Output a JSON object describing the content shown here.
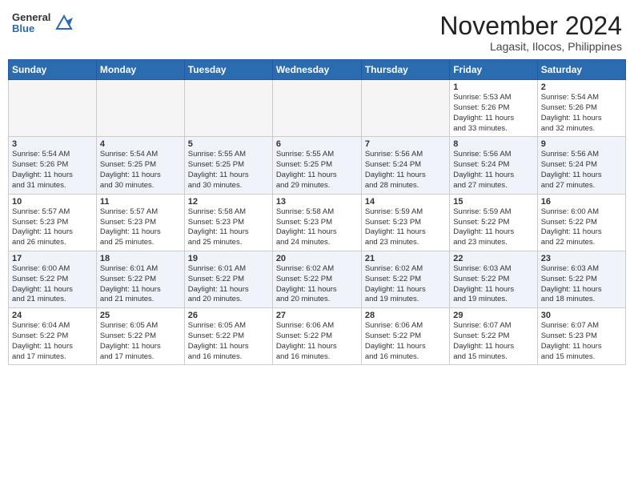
{
  "header": {
    "logo_general": "General",
    "logo_blue": "Blue",
    "month_year": "November 2024",
    "location": "Lagasit, Ilocos, Philippines"
  },
  "days_of_week": [
    "Sunday",
    "Monday",
    "Tuesday",
    "Wednesday",
    "Thursday",
    "Friday",
    "Saturday"
  ],
  "weeks": [
    {
      "row_class": "row-white",
      "days": [
        {
          "num": "",
          "info": "",
          "empty": true
        },
        {
          "num": "",
          "info": "",
          "empty": true
        },
        {
          "num": "",
          "info": "",
          "empty": true
        },
        {
          "num": "",
          "info": "",
          "empty": true
        },
        {
          "num": "",
          "info": "",
          "empty": true
        },
        {
          "num": "1",
          "info": "Sunrise: 5:53 AM\nSunset: 5:26 PM\nDaylight: 11 hours\nand 33 minutes."
        },
        {
          "num": "2",
          "info": "Sunrise: 5:54 AM\nSunset: 5:26 PM\nDaylight: 11 hours\nand 32 minutes."
        }
      ]
    },
    {
      "row_class": "row-blue",
      "days": [
        {
          "num": "3",
          "info": "Sunrise: 5:54 AM\nSunset: 5:26 PM\nDaylight: 11 hours\nand 31 minutes."
        },
        {
          "num": "4",
          "info": "Sunrise: 5:54 AM\nSunset: 5:25 PM\nDaylight: 11 hours\nand 30 minutes."
        },
        {
          "num": "5",
          "info": "Sunrise: 5:55 AM\nSunset: 5:25 PM\nDaylight: 11 hours\nand 30 minutes."
        },
        {
          "num": "6",
          "info": "Sunrise: 5:55 AM\nSunset: 5:25 PM\nDaylight: 11 hours\nand 29 minutes."
        },
        {
          "num": "7",
          "info": "Sunrise: 5:56 AM\nSunset: 5:24 PM\nDaylight: 11 hours\nand 28 minutes."
        },
        {
          "num": "8",
          "info": "Sunrise: 5:56 AM\nSunset: 5:24 PM\nDaylight: 11 hours\nand 27 minutes."
        },
        {
          "num": "9",
          "info": "Sunrise: 5:56 AM\nSunset: 5:24 PM\nDaylight: 11 hours\nand 27 minutes."
        }
      ]
    },
    {
      "row_class": "row-white",
      "days": [
        {
          "num": "10",
          "info": "Sunrise: 5:57 AM\nSunset: 5:23 PM\nDaylight: 11 hours\nand 26 minutes."
        },
        {
          "num": "11",
          "info": "Sunrise: 5:57 AM\nSunset: 5:23 PM\nDaylight: 11 hours\nand 25 minutes."
        },
        {
          "num": "12",
          "info": "Sunrise: 5:58 AM\nSunset: 5:23 PM\nDaylight: 11 hours\nand 25 minutes."
        },
        {
          "num": "13",
          "info": "Sunrise: 5:58 AM\nSunset: 5:23 PM\nDaylight: 11 hours\nand 24 minutes."
        },
        {
          "num": "14",
          "info": "Sunrise: 5:59 AM\nSunset: 5:23 PM\nDaylight: 11 hours\nand 23 minutes."
        },
        {
          "num": "15",
          "info": "Sunrise: 5:59 AM\nSunset: 5:22 PM\nDaylight: 11 hours\nand 23 minutes."
        },
        {
          "num": "16",
          "info": "Sunrise: 6:00 AM\nSunset: 5:22 PM\nDaylight: 11 hours\nand 22 minutes."
        }
      ]
    },
    {
      "row_class": "row-blue",
      "days": [
        {
          "num": "17",
          "info": "Sunrise: 6:00 AM\nSunset: 5:22 PM\nDaylight: 11 hours\nand 21 minutes."
        },
        {
          "num": "18",
          "info": "Sunrise: 6:01 AM\nSunset: 5:22 PM\nDaylight: 11 hours\nand 21 minutes."
        },
        {
          "num": "19",
          "info": "Sunrise: 6:01 AM\nSunset: 5:22 PM\nDaylight: 11 hours\nand 20 minutes."
        },
        {
          "num": "20",
          "info": "Sunrise: 6:02 AM\nSunset: 5:22 PM\nDaylight: 11 hours\nand 20 minutes."
        },
        {
          "num": "21",
          "info": "Sunrise: 6:02 AM\nSunset: 5:22 PM\nDaylight: 11 hours\nand 19 minutes."
        },
        {
          "num": "22",
          "info": "Sunrise: 6:03 AM\nSunset: 5:22 PM\nDaylight: 11 hours\nand 19 minutes."
        },
        {
          "num": "23",
          "info": "Sunrise: 6:03 AM\nSunset: 5:22 PM\nDaylight: 11 hours\nand 18 minutes."
        }
      ]
    },
    {
      "row_class": "row-white",
      "days": [
        {
          "num": "24",
          "info": "Sunrise: 6:04 AM\nSunset: 5:22 PM\nDaylight: 11 hours\nand 17 minutes."
        },
        {
          "num": "25",
          "info": "Sunrise: 6:05 AM\nSunset: 5:22 PM\nDaylight: 11 hours\nand 17 minutes."
        },
        {
          "num": "26",
          "info": "Sunrise: 6:05 AM\nSunset: 5:22 PM\nDaylight: 11 hours\nand 16 minutes."
        },
        {
          "num": "27",
          "info": "Sunrise: 6:06 AM\nSunset: 5:22 PM\nDaylight: 11 hours\nand 16 minutes."
        },
        {
          "num": "28",
          "info": "Sunrise: 6:06 AM\nSunset: 5:22 PM\nDaylight: 11 hours\nand 16 minutes."
        },
        {
          "num": "29",
          "info": "Sunrise: 6:07 AM\nSunset: 5:22 PM\nDaylight: 11 hours\nand 15 minutes."
        },
        {
          "num": "30",
          "info": "Sunrise: 6:07 AM\nSunset: 5:23 PM\nDaylight: 11 hours\nand 15 minutes."
        }
      ]
    }
  ]
}
